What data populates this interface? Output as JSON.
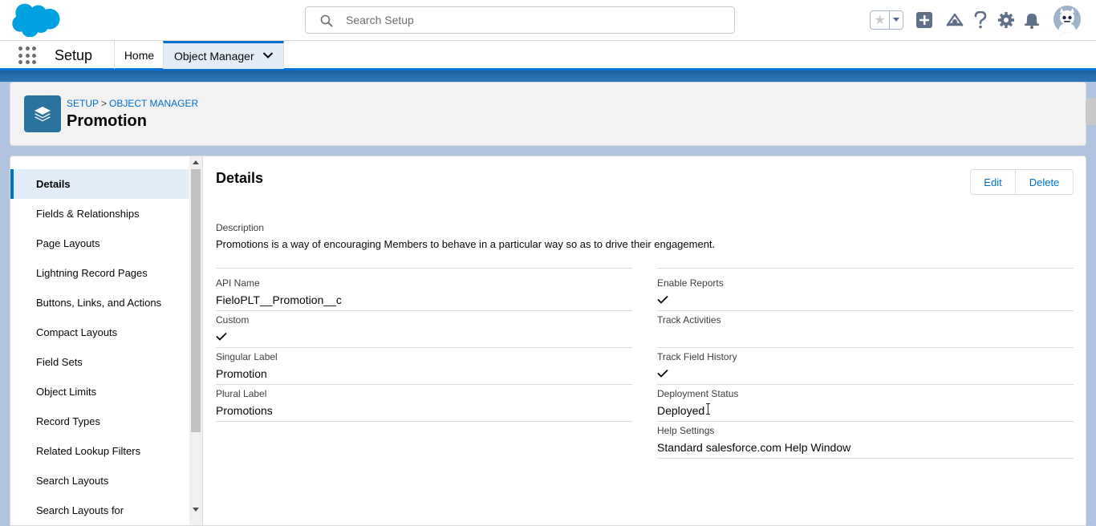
{
  "header": {
    "search_placeholder": "Search Setup"
  },
  "context_bar": {
    "app_name": "Setup",
    "tabs": [
      {
        "label": "Home"
      },
      {
        "label": "Object Manager"
      }
    ]
  },
  "page_header": {
    "breadcrumb": [
      "SETUP",
      "OBJECT MANAGER"
    ],
    "breadcrumb_separator": ">",
    "title": "Promotion",
    "icon": "layers-icon"
  },
  "sidebar": {
    "items": [
      {
        "label": "Details",
        "active": true
      },
      {
        "label": "Fields & Relationships"
      },
      {
        "label": "Page Layouts"
      },
      {
        "label": "Lightning Record Pages"
      },
      {
        "label": "Buttons, Links, and Actions"
      },
      {
        "label": "Compact Layouts"
      },
      {
        "label": "Field Sets"
      },
      {
        "label": "Object Limits"
      },
      {
        "label": "Record Types"
      },
      {
        "label": "Related Lookup Filters"
      },
      {
        "label": "Search Layouts"
      },
      {
        "label": "Search Layouts for"
      }
    ]
  },
  "details": {
    "title": "Details",
    "edit_label": "Edit",
    "delete_label": "Delete",
    "description_label": "Description",
    "description_value": "Promotions is a way of encouraging Members to behave in a particular way so as to drive their engagement.",
    "left_fields": [
      {
        "label": "API Name",
        "value": "FieloPLT__Promotion__c"
      },
      {
        "label": "Custom",
        "checked": true
      },
      {
        "label": "Singular Label",
        "value": "Promotion"
      },
      {
        "label": "Plural Label",
        "value": "Promotions"
      }
    ],
    "right_fields": [
      {
        "label": "Enable Reports",
        "checked": true
      },
      {
        "label": "Track Activities",
        "checked": false
      },
      {
        "label": "Track Field History",
        "checked": true
      },
      {
        "label": "Deployment Status",
        "value": "Deployed"
      },
      {
        "label": "Help Settings",
        "value": "Standard salesforce.com Help Window"
      }
    ]
  },
  "colors": {
    "brand_blue": "#0070d2",
    "salesforce_cloud": "#00a1e0",
    "object_icon_bg": "#2a739e"
  }
}
